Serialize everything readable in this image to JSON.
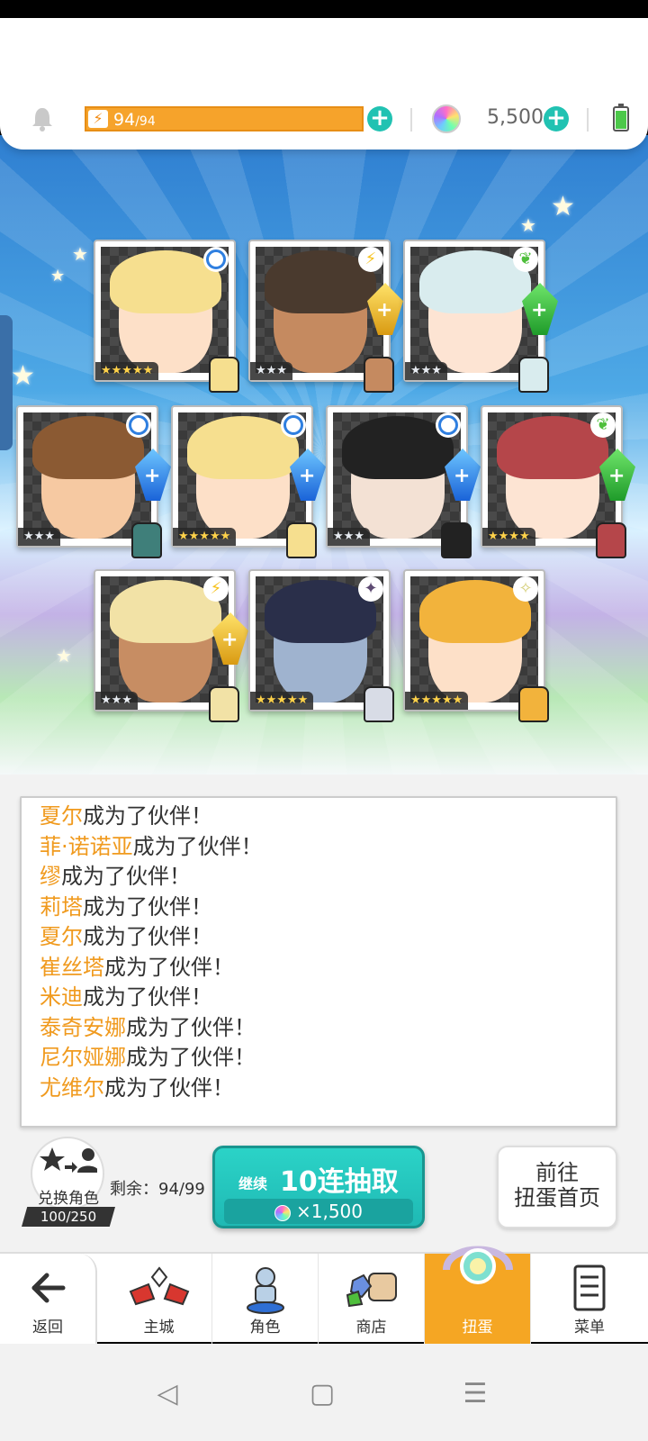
{
  "top_bar": {
    "energy_current": "94",
    "energy_max": "94",
    "gems": "5,500"
  },
  "cards_row1": [
    {
      "element": "water",
      "stars": "★★★★★",
      "star_color": "gold",
      "hair": "#f6df8f",
      "skin": "#fde0c8",
      "sprite": "#f6df8f"
    },
    {
      "element": "thunder",
      "stars": "★★★",
      "star_color": "silver",
      "hair": "#4a3a2e",
      "skin": "#c58a60",
      "sprite": "#c58a60",
      "crystal": "thunder"
    },
    {
      "element": "earth",
      "stars": "★★★",
      "star_color": "silver",
      "hair": "#d9ecee",
      "skin": "#fde4d3",
      "sprite": "#d9ecee",
      "crystal": "earth"
    }
  ],
  "cards_row2": [
    {
      "element": "water",
      "stars": "★★★",
      "star_color": "silver",
      "hair": "#8b5a33",
      "skin": "#f6c9a2",
      "sprite": "#3f7f7a",
      "crystal": "water"
    },
    {
      "element": "water",
      "stars": "★★★★★",
      "star_color": "gold",
      "hair": "#f6df8f",
      "skin": "#fde0c8",
      "sprite": "#f6df8f",
      "crystal": "water"
    },
    {
      "element": "water",
      "stars": "★★★",
      "star_color": "silver",
      "hair": "#222222",
      "skin": "#f3e1d4",
      "sprite": "#222222",
      "crystal": "water"
    },
    {
      "element": "earth",
      "stars": "★★★★",
      "star_color": "gold",
      "hair": "#b5464a",
      "skin": "#fde4d3",
      "sprite": "#b5464a",
      "crystal": "earth"
    }
  ],
  "cards_row3": [
    {
      "element": "thunder",
      "stars": "★★★",
      "star_color": "silver",
      "hair": "#f2e2a6",
      "skin": "#c78d63",
      "sprite": "#f2e2a6",
      "crystal": "thunder"
    },
    {
      "element": "dark",
      "stars": "★★★★★",
      "star_color": "gold",
      "hair": "#2a2f4a",
      "skin": "#9fb3cf",
      "sprite": "#d8dce6"
    },
    {
      "element": "light",
      "stars": "★★★★★",
      "star_color": "gold",
      "hair": "#f2b33c",
      "skin": "#fde0c8",
      "sprite": "#f2b33c"
    }
  ],
  "log": [
    {
      "name": "夏尔",
      "suffix": "成为了伙伴！"
    },
    {
      "name": "菲·诺诺亚",
      "suffix": "成为了伙伴！"
    },
    {
      "name": "缪",
      "suffix": "成为了伙伴！"
    },
    {
      "name": "莉塔",
      "suffix": "成为了伙伴！"
    },
    {
      "name": "夏尔",
      "suffix": "成为了伙伴！"
    },
    {
      "name": "崔丝塔",
      "suffix": "成为了伙伴！"
    },
    {
      "name": "米迪",
      "suffix": "成为了伙伴！"
    },
    {
      "name": "泰奇安娜",
      "suffix": "成为了伙伴！"
    },
    {
      "name": "尼尔娅娜",
      "suffix": "成为了伙伴！"
    },
    {
      "name": "尤维尔",
      "suffix": "成为了伙伴！"
    }
  ],
  "swap": {
    "label": "兑换角色",
    "count": "100/250"
  },
  "remain": {
    "label": "剩余：94/99"
  },
  "pull_button": {
    "continue": "继续",
    "title": "10连抽取",
    "cost": "×1,500"
  },
  "gacha_home": {
    "line1": "前往",
    "line2": "扭蛋首页"
  },
  "nav": {
    "back": "返回",
    "items": [
      "主城",
      "角色",
      "商店",
      "扭蛋",
      "菜单"
    ]
  },
  "colors": {
    "accent_orange": "#f5a623",
    "teal_button": "#21c2b2",
    "name_orange": "#f09a1e"
  }
}
